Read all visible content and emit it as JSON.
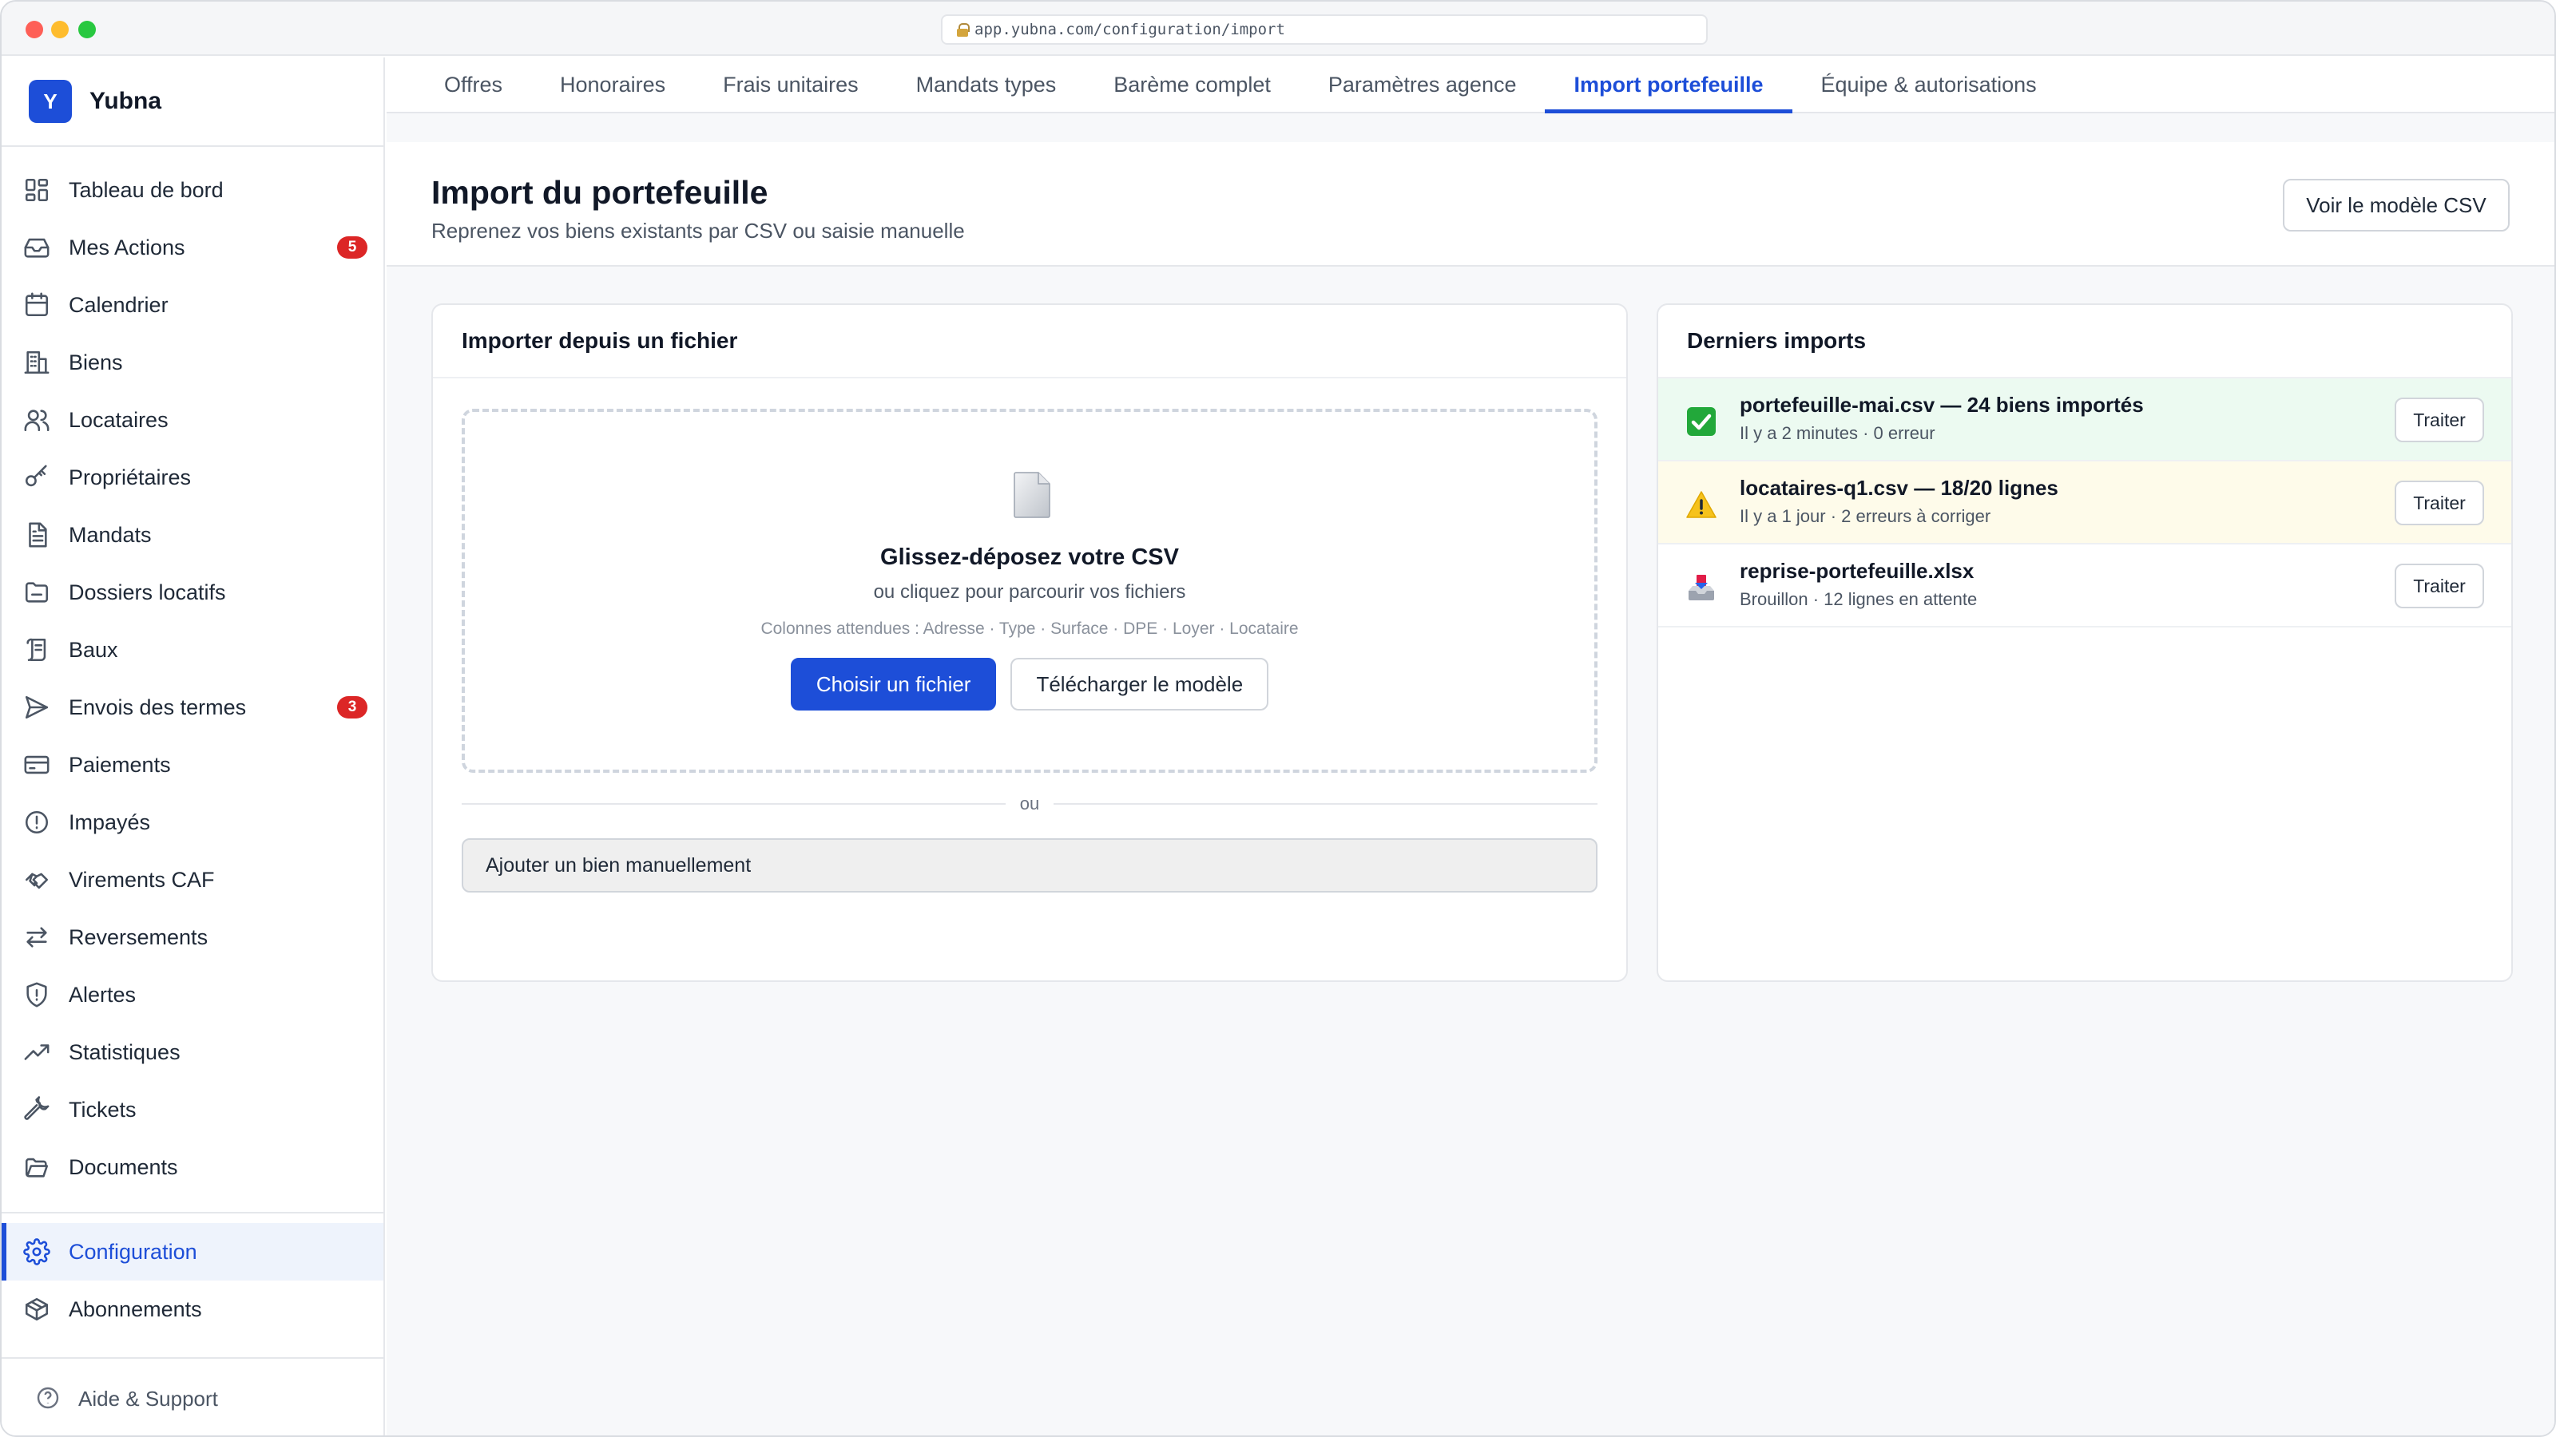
{
  "browser": {
    "url": "app.yubna.com/configuration/import"
  },
  "brand": {
    "initial": "Y",
    "name": "Yubna"
  },
  "sidebar": {
    "items": [
      {
        "label": "Tableau de bord",
        "icon": "dashboard-icon"
      },
      {
        "label": "Mes Actions",
        "icon": "inbox-icon",
        "badge": "5"
      },
      {
        "label": "Calendrier",
        "icon": "calendar-icon"
      },
      {
        "label": "Biens",
        "icon": "building-icon"
      },
      {
        "label": "Locataires",
        "icon": "users-icon"
      },
      {
        "label": "Propriétaires",
        "icon": "key-icon"
      },
      {
        "label": "Mandats",
        "icon": "document-icon"
      },
      {
        "label": "Dossiers locatifs",
        "icon": "folder-icon"
      },
      {
        "label": "Baux",
        "icon": "scroll-icon"
      },
      {
        "label": "Envois des termes",
        "icon": "send-icon",
        "badge": "3"
      },
      {
        "label": "Paiements",
        "icon": "credit-card-icon"
      },
      {
        "label": "Impayés",
        "icon": "alert-circle-icon"
      },
      {
        "label": "Virements CAF",
        "icon": "handshake-icon"
      },
      {
        "label": "Reversements",
        "icon": "arrows-exchange-icon"
      },
      {
        "label": "Alertes",
        "icon": "shield-alert-icon"
      },
      {
        "label": "Statistiques",
        "icon": "trending-up-icon"
      },
      {
        "label": "Tickets",
        "icon": "wrench-icon"
      },
      {
        "label": "Documents",
        "icon": "folder-open-icon"
      }
    ],
    "bottom_items": [
      {
        "label": "Configuration",
        "icon": "gear-icon",
        "active": true
      },
      {
        "label": "Abonnements",
        "icon": "box-icon"
      }
    ],
    "support": "Aide & Support"
  },
  "tabs": [
    {
      "label": "Offres"
    },
    {
      "label": "Honoraires"
    },
    {
      "label": "Frais unitaires"
    },
    {
      "label": "Mandats types"
    },
    {
      "label": "Barème complet"
    },
    {
      "label": "Paramètres agence"
    },
    {
      "label": "Import portefeuille",
      "active": true
    },
    {
      "label": "Équipe & autorisations"
    }
  ],
  "page": {
    "title": "Import du portefeuille",
    "subtitle": "Reprenez vos biens existants par CSV ou saisie manuelle",
    "csv_model_button": "Voir le modèle CSV"
  },
  "upload": {
    "title": "Importer depuis un fichier",
    "drop_title": "Glissez-déposez votre CSV",
    "drop_sub": "ou cliquez pour parcourir vos fichiers",
    "expected_columns": "Colonnes attendues : Adresse · Type · Surface · DPE · Loyer · Locataire",
    "choose_button": "Choisir un fichier",
    "download_button": "Télécharger le modèle",
    "or_label": "ou",
    "manual_button": "Ajouter un bien manuellement"
  },
  "recent": {
    "title": "Derniers imports",
    "items": [
      {
        "name": "portefeuille-mai.csv — 24 biens importés",
        "meta": "Il y a 2 minutes · 0 erreur",
        "status": "success",
        "icon": "check-icon",
        "action": "Traiter"
      },
      {
        "name": "locataires-q1.csv — 18/20 lignes",
        "meta": "Il y a 1 jour · 2 erreurs à corriger",
        "status": "warning",
        "icon": "warning-icon",
        "action": "Traiter"
      },
      {
        "name": "reprise-portefeuille.xlsx",
        "meta": "Brouillon · 12 lignes en attente",
        "status": "draft",
        "icon": "inbox-tray-icon",
        "action": "Traiter"
      }
    ]
  },
  "colors": {
    "accent": "#1d4ed8",
    "badge": "#dc2626",
    "success_bg": "#ecfaf1",
    "warning_bg": "#fefbea"
  }
}
